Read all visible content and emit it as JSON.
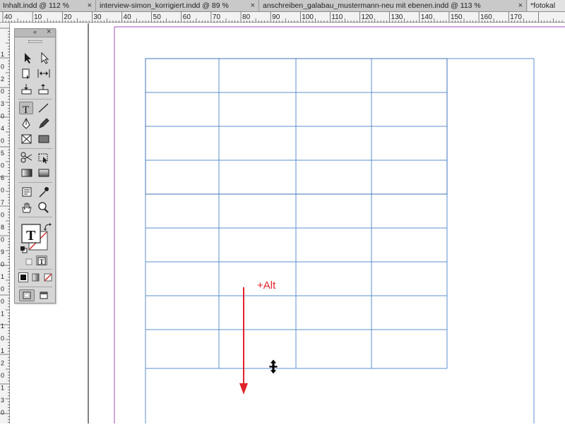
{
  "tabs": [
    {
      "label": "Inhalt.indd @ 112 %",
      "close": "×",
      "active": false
    },
    {
      "label": "interview-simon_korrigiert.indd @ 89 %",
      "close": "×",
      "active": false
    },
    {
      "label": "anschreiben_galabau_mustermann-neu mit ebenen.indd @ 113 %",
      "close": "×",
      "active": false
    },
    {
      "label": "*fotokal",
      "close": "",
      "active": true
    }
  ],
  "ruler": {
    "labels": [
      "40",
      "10",
      "20",
      "30",
      "40",
      "50",
      "60",
      "70",
      "80",
      "90",
      "100",
      "110",
      "120",
      "130",
      "140",
      "150",
      "160",
      "170"
    ],
    "vertical_labels": [
      "1",
      "0",
      "2",
      "0",
      "3",
      "0",
      "4",
      "0",
      "5",
      "0",
      "6",
      "0",
      "7",
      "0",
      "8",
      "0",
      "9",
      "0",
      "1",
      "0",
      "0",
      "1",
      "1",
      "0",
      "1",
      "2",
      "0",
      "1",
      "3",
      "0"
    ]
  },
  "tools_panel": {
    "collapse_label": "«",
    "close_label": "×",
    "tools": [
      {
        "name": "selection-tool-icon"
      },
      {
        "name": "direct-selection-tool-icon"
      },
      {
        "name": "page-tool-icon"
      },
      {
        "name": "gap-tool-icon"
      },
      {
        "name": "content-collector-icon"
      },
      {
        "name": "content-placer-icon"
      },
      {
        "name": "type-tool-icon",
        "active": true
      },
      {
        "name": "line-tool-icon"
      },
      {
        "name": "pen-tool-icon"
      },
      {
        "name": "pencil-tool-icon"
      },
      {
        "name": "rectangle-frame-tool-icon"
      },
      {
        "name": "rectangle-tool-icon"
      },
      {
        "name": "scissors-tool-icon"
      },
      {
        "name": "free-transform-tool-icon"
      },
      {
        "name": "gradient-swatch-tool-icon"
      },
      {
        "name": "gradient-feather-tool-icon"
      },
      {
        "name": "note-tool-icon"
      },
      {
        "name": "eyedropper-tool-icon"
      },
      {
        "name": "hand-tool-icon"
      },
      {
        "name": "zoom-tool-icon"
      }
    ],
    "fill_stroke_letter": "T"
  },
  "document": {
    "table": {
      "rows": 9,
      "columns": 4
    },
    "annotation": {
      "text": "+Alt",
      "color": "#e0242b"
    }
  },
  "colors": {
    "table_line": "#5b8fd0",
    "margin_guide": "#a24fbf",
    "annotation_red": "#e0242b"
  }
}
